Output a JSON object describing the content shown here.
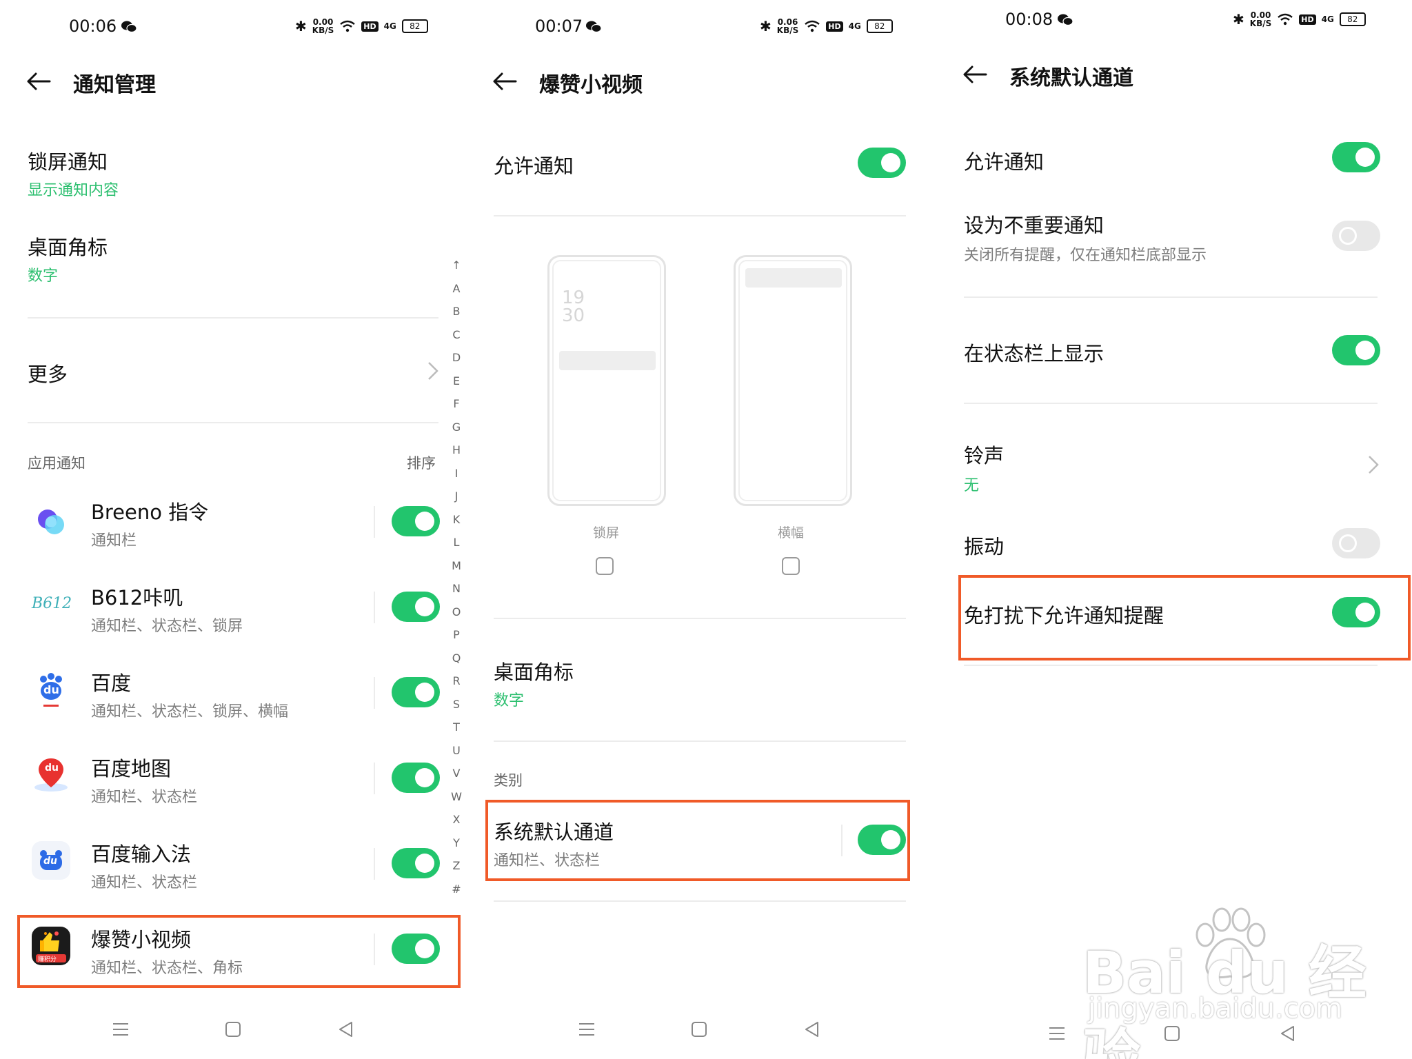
{
  "panel1": {
    "status": {
      "time": "00:06",
      "speed": "0.00\nKB/S",
      "hd": "HD",
      "signal": "4G",
      "battery": "82"
    },
    "header": {
      "title": "通知管理"
    },
    "lockscreen": {
      "title": "锁屏通知",
      "value": "显示通知内容"
    },
    "badge": {
      "title": "桌面角标",
      "value": "数字"
    },
    "more": {
      "title": "更多"
    },
    "section": {
      "label": "应用通知",
      "sort": "排序"
    },
    "apps": [
      {
        "name": "Breeno 指令",
        "desc": "通知栏"
      },
      {
        "name": "B612咔叽",
        "desc": "通知栏、状态栏、锁屏"
      },
      {
        "name": "百度",
        "desc": "通知栏、状态栏、锁屏、横幅"
      },
      {
        "name": "百度地图",
        "desc": "通知栏、状态栏"
      },
      {
        "name": "百度输入法",
        "desc": "通知栏、状态栏"
      },
      {
        "name": "爆赞小视频",
        "desc": "通知栏、状态栏、角标"
      }
    ],
    "alphabet": [
      "↑",
      "A",
      "B",
      "C",
      "D",
      "E",
      "F",
      "G",
      "H",
      "I",
      "J",
      "K",
      "L",
      "M",
      "N",
      "O",
      "P",
      "Q",
      "R",
      "S",
      "T",
      "U",
      "V",
      "W",
      "X",
      "Y",
      "Z",
      "#"
    ],
    "icon_text": {
      "b612": "B612",
      "baidu": "du",
      "map": "du",
      "ime": "du",
      "bz_badge": "赚积分"
    }
  },
  "panel2": {
    "status": {
      "time": "00:07",
      "speed": "0.06\nKB/S",
      "hd": "HD",
      "signal": "4G",
      "battery": "82"
    },
    "header": {
      "title": "爆赞小视频"
    },
    "allow": {
      "title": "允许通知"
    },
    "preview": {
      "lock_label": "锁屏",
      "banner_label": "横幅",
      "clock": "19\n30"
    },
    "badge": {
      "title": "桌面角标",
      "value": "数字"
    },
    "category": {
      "label": "类别"
    },
    "channel": {
      "title": "系统默认通道",
      "desc": "通知栏、状态栏"
    }
  },
  "panel3": {
    "status": {
      "time": "00:08",
      "speed": "0.00\nKB/S",
      "hd": "HD",
      "signal": "4G",
      "battery": "82"
    },
    "header": {
      "title": "系统默认通道"
    },
    "allow": {
      "title": "允许通知"
    },
    "unimportant": {
      "title": "设为不重要通知",
      "desc": "关闭所有提醒，仅在通知栏底部显示"
    },
    "statusbar": {
      "title": "在状态栏上显示"
    },
    "ringtone": {
      "title": "铃声",
      "value": "无"
    },
    "vibrate": {
      "title": "振动"
    },
    "dnd": {
      "title": "免打扰下允许通知提醒"
    },
    "watermark": {
      "brand": "Bai du 经验",
      "url": "jingyan.baidu.com"
    }
  },
  "colors": {
    "accent": "#22c56d",
    "highlight": "#f05a28"
  }
}
